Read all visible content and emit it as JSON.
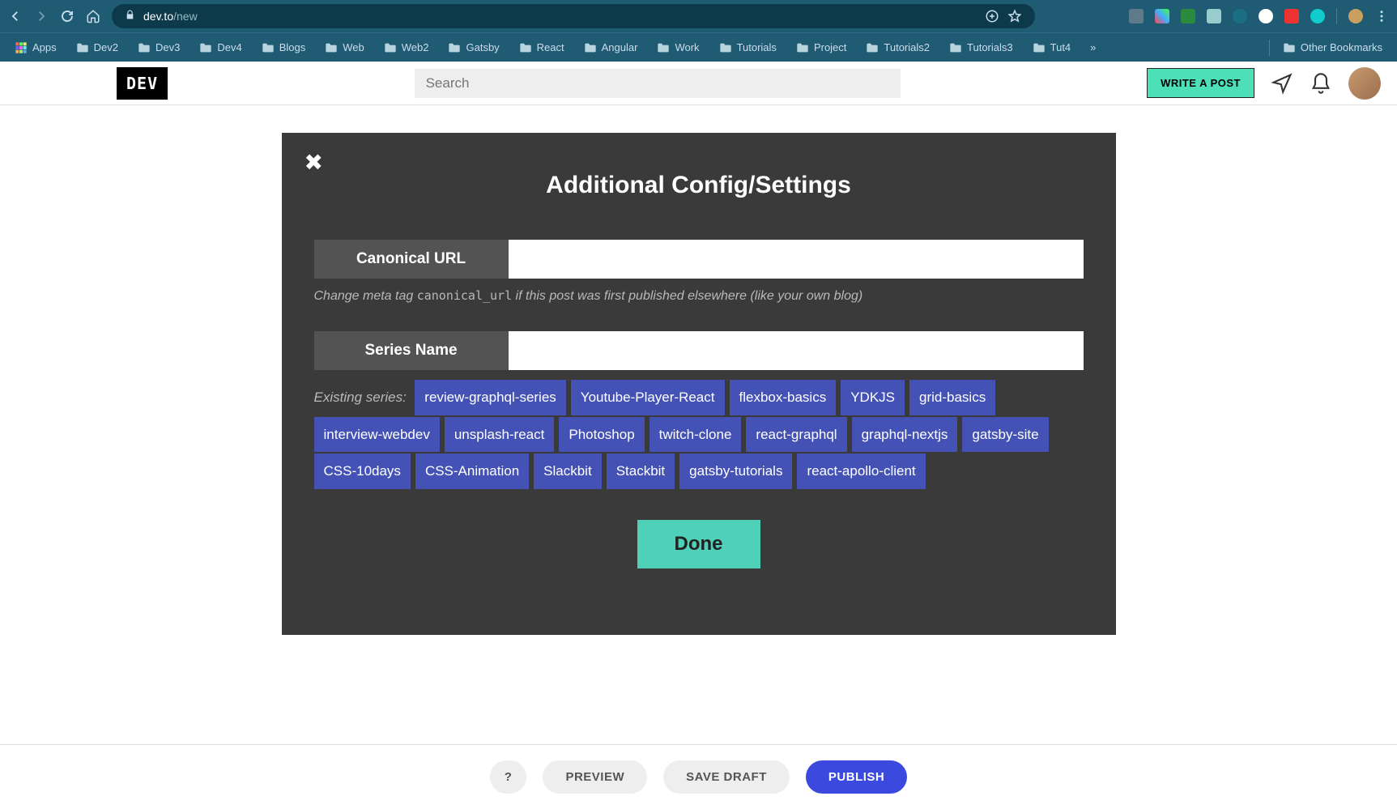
{
  "browser": {
    "url_domain": "dev.to",
    "url_path": "/new",
    "bookmarks": [
      "Apps",
      "Dev2",
      "Dev3",
      "Dev4",
      "Blogs",
      "Web",
      "Web2",
      "Gatsby",
      "React",
      "Angular",
      "Work",
      "Tutorials",
      "Project",
      "Tutorials2",
      "Tutorials3",
      "Tut4"
    ],
    "overflow": "»",
    "other_bookmarks": "Other Bookmarks"
  },
  "header": {
    "logo": "DEV",
    "search_placeholder": "Search",
    "write_post": "WRITE A POST"
  },
  "modal": {
    "title": "Additional Config/Settings",
    "canonical_label": "Canonical URL",
    "canonical_hint_prefix": "Change meta tag ",
    "canonical_hint_code": "canonical_url",
    "canonical_hint_suffix": " if this post was first published elsewhere (like your own blog)",
    "series_label": "Series Name",
    "existing_series_label": "Existing series:",
    "series_tags": [
      "review-graphql-series",
      "Youtube-Player-React",
      "flexbox-basics",
      "YDKJS",
      "grid-basics",
      "interview-webdev",
      "unsplash-react",
      "Photoshop",
      "twitch-clone",
      "react-graphql",
      "graphql-nextjs",
      "gatsby-site",
      "CSS-10days",
      "CSS-Animation",
      "Slackbit",
      "Stackbit",
      "gatsby-tutorials",
      "react-apollo-client"
    ],
    "done": "Done"
  },
  "footer": {
    "help": "?",
    "preview": "PREVIEW",
    "save_draft": "SAVE DRAFT",
    "publish": "PUBLISH"
  }
}
